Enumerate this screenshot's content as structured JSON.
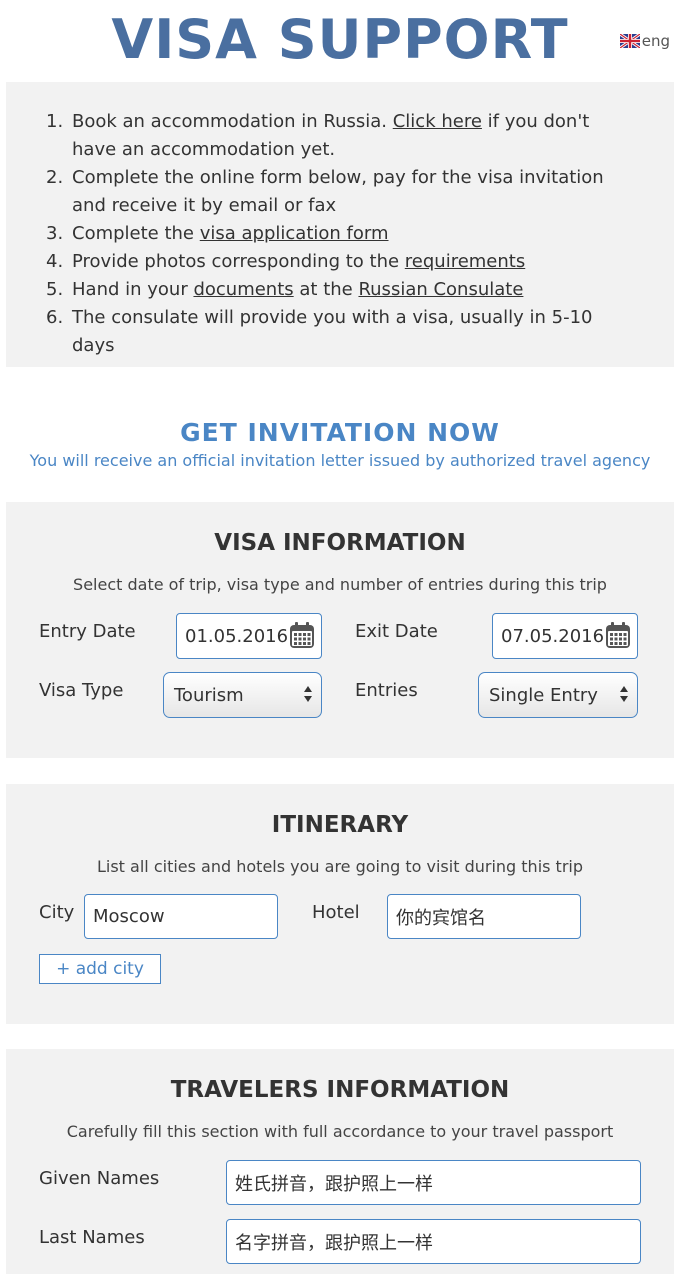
{
  "header": {
    "title": "VISA SUPPORT",
    "lang_label": "eng",
    "flag_icon": "uk-flag-icon"
  },
  "steps": [
    {
      "num": "1.",
      "parts": [
        "Book an accommodation in Russia. ",
        "Click here",
        " if you don't have an accommodation yet."
      ]
    },
    {
      "num": "2.",
      "text": "Complete the online form below, pay for the visa invitation and receive it by email or fax"
    },
    {
      "num": "3.",
      "parts": [
        "Complete the ",
        "visa application form"
      ]
    },
    {
      "num": "4.",
      "parts": [
        "Provide photos corresponding to the ",
        "requirements"
      ]
    },
    {
      "num": "5.",
      "parts": [
        "Hand in your ",
        "documents",
        " at the ",
        "Russian Consulate"
      ]
    },
    {
      "num": "6.",
      "text": "The consulate will provide you with a visa, usually in 5-10 days"
    }
  ],
  "cta": {
    "title": "GET INVITATION NOW",
    "subtitle": "You will receive an official invitation letter issued by authorized travel agency"
  },
  "visa_info": {
    "title": "VISA INFORMATION",
    "subtitle": "Select date of trip, visa type and number of entries during this trip",
    "entry_date_label": "Entry Date",
    "entry_date_value": "01.05.2016",
    "exit_date_label": "Exit Date",
    "exit_date_value": "07.05.2016",
    "visa_type_label": "Visa Type",
    "visa_type_value": "Tourism",
    "entries_label": "Entries",
    "entries_value": "Single Entry",
    "calendar_icon": "calendar-icon"
  },
  "itinerary": {
    "title": "ITINERARY",
    "subtitle": "List all cities and hotels you are going to visit during this trip",
    "city_label": "City",
    "city_value": "Moscow",
    "hotel_label": "Hotel",
    "hotel_value": "你的宾馆名",
    "add_city_label": "+ add city"
  },
  "travelers": {
    "title": "TRAVELERS INFORMATION",
    "subtitle": "Carefully fill this section with full accordance to your travel passport",
    "given_names_label": "Given Names",
    "given_names_value": "姓氏拼音，跟护照上一样",
    "last_names_label": "Last Names",
    "last_names_value": "名字拼音，跟护照上一样"
  },
  "colors": {
    "title_blue": "#4a6fa0",
    "accent_blue": "#4a86c5",
    "panel_bg": "#f2f2f2",
    "text": "#333333"
  }
}
